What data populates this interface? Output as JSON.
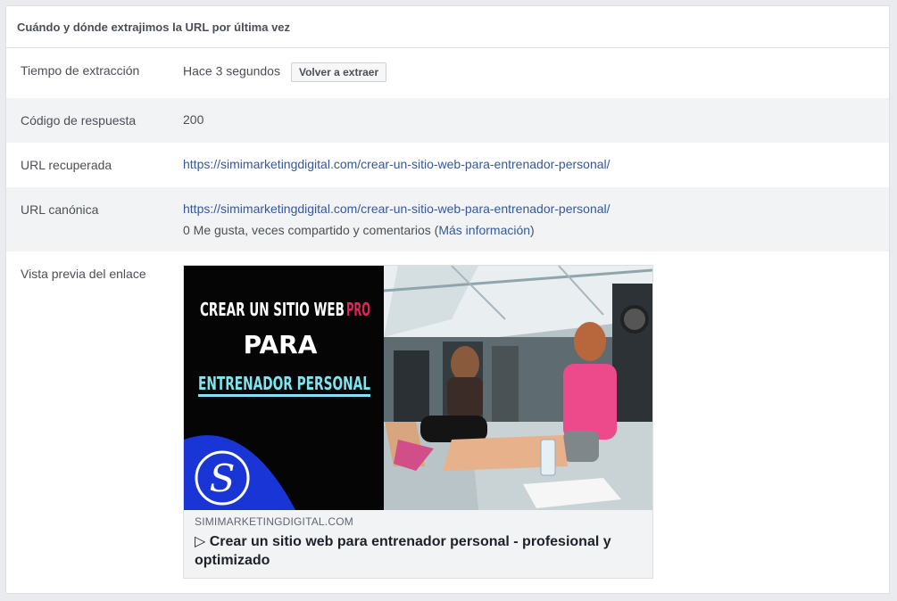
{
  "header": {
    "title": "Cuándo y dónde extrajimos la URL por última vez"
  },
  "rows": {
    "extraction_time": {
      "label": "Tiempo de extracción",
      "value": "Hace 3 segundos",
      "button": "Volver a extraer"
    },
    "response_code": {
      "label": "Código de respuesta",
      "value": "200"
    },
    "fetched_url": {
      "label": "URL recuperada",
      "value": "https://simimarketingdigital.com/crear-un-sitio-web-para-entrenador-personal/"
    },
    "canonical_url": {
      "label": "URL canónica",
      "value": "https://simimarketingdigital.com/crear-un-sitio-web-para-entrenador-personal/",
      "stats_text": "0 Me gusta, veces compartido y comentarios (",
      "more_info": "Más información",
      "stats_close": ")"
    },
    "link_preview": {
      "label": "Vista previa del enlace",
      "image": {
        "line1a": "CREAR UN SITIO WEB",
        "line1b": "PRO",
        "line2": "PARA",
        "line3": "ENTRENADOR PERSONAL",
        "logo_letter": "S"
      },
      "domain": "SIMIMARKETINGDIGITAL.COM",
      "title": "▷ Crear un sitio web para entrenador personal - profesional y optimizado"
    }
  },
  "colors": {
    "link": "#365899",
    "accent_red": "#e0245e",
    "accent_cyan": "#7fe3f0",
    "brand_blue": "#1a35d6"
  }
}
